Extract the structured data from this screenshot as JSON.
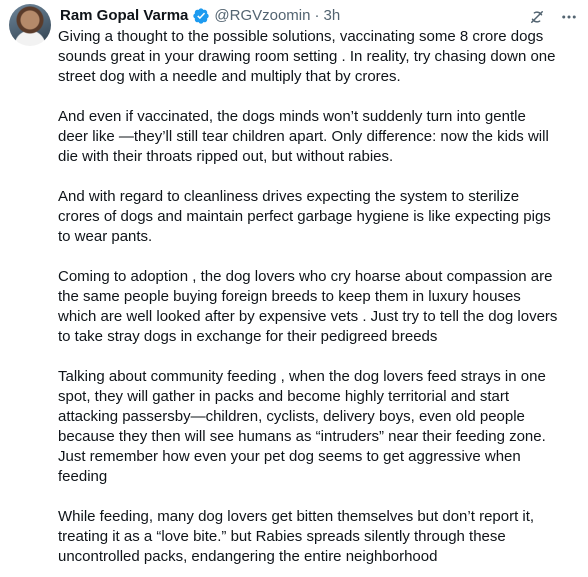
{
  "tweet": {
    "author_name": "Ram Gopal Varma",
    "handle": "@RGVzoomin",
    "separator": "·",
    "time": "3h",
    "paragraphs": [
      "Giving a thought to the possible solutions, vaccinating some 8 crore dogs\nsounds great  in your drawing room setting . In reality, try chasing down one\nstreet dog with a needle and multiply that by crores.",
      "And even if vaccinated, the dogs minds won’t suddenly turn into gentle\ndeer like   —they’ll still tear children apart. Only difference: now the kids will\ndie with their throats ripped out,  but without rabies.",
      "And with regard to cleanliness drives expecting the system to sterilize\ncrores of dogs and maintain perfect garbage hygiene is like expecting pigs\nto wear pants.",
      "Coming to adoption , the dog lovers who cry hoarse about compassion are\nthe same people buying foreign breeds to keep them in luxury houses\nwhich are well looked after by expensive vets . Just try to tell the dog lovers\nto take stray dogs in exchange for their pedigreed breeds",
      "Talking about community feeding , when the dog lovers feed strays in one\nspot, they will gather in packs and become highly territorial and start\nattacking passersby—children, cyclists, delivery boys, even old people\nbecause they then will see humans as “intruders” near their feeding zone.\nJust remember how even your pet dog seems to get aggressive when\nfeeding",
      "While feeding, many dog lovers get bitten themselves but don’t report it,\ntreating it as a “love bite.” but Rabies spreads silently through these\nuncontrolled packs, endangering the entire neighborhood"
    ]
  },
  "icons": {
    "avatar": "profile-photo",
    "verified": "verified-badge-icon",
    "grok": "grok-icon",
    "more": "more-icon"
  },
  "colors": {
    "text": "#0f1419",
    "secondary": "#536471",
    "verified": "#1d9bf0",
    "background": "#ffffff"
  }
}
